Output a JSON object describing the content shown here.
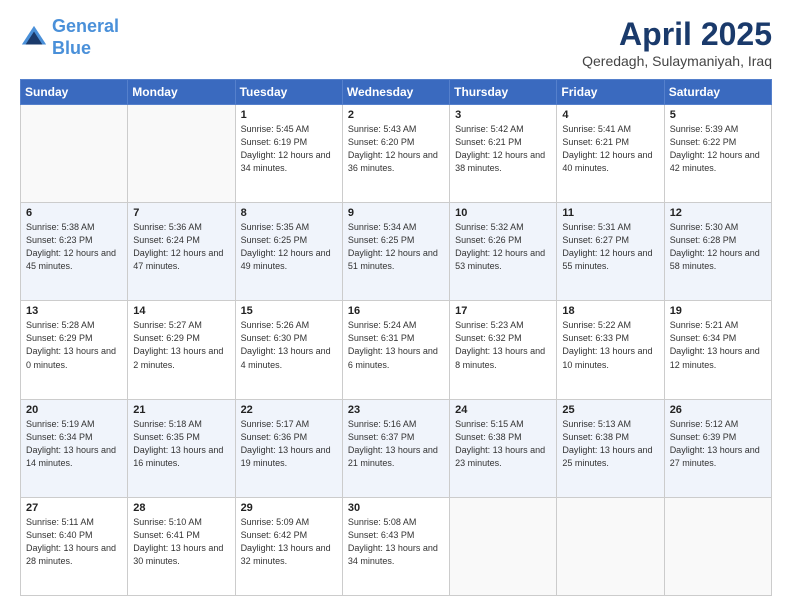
{
  "logo": {
    "line1": "General",
    "line2": "Blue"
  },
  "header": {
    "month": "April 2025",
    "location": "Qeredagh, Sulaymaniyah, Iraq"
  },
  "weekdays": [
    "Sunday",
    "Monday",
    "Tuesday",
    "Wednesday",
    "Thursday",
    "Friday",
    "Saturday"
  ],
  "weeks": [
    [
      {
        "day": "",
        "info": ""
      },
      {
        "day": "",
        "info": ""
      },
      {
        "day": "1",
        "info": "Sunrise: 5:45 AM\nSunset: 6:19 PM\nDaylight: 12 hours and 34 minutes."
      },
      {
        "day": "2",
        "info": "Sunrise: 5:43 AM\nSunset: 6:20 PM\nDaylight: 12 hours and 36 minutes."
      },
      {
        "day": "3",
        "info": "Sunrise: 5:42 AM\nSunset: 6:21 PM\nDaylight: 12 hours and 38 minutes."
      },
      {
        "day": "4",
        "info": "Sunrise: 5:41 AM\nSunset: 6:21 PM\nDaylight: 12 hours and 40 minutes."
      },
      {
        "day": "5",
        "info": "Sunrise: 5:39 AM\nSunset: 6:22 PM\nDaylight: 12 hours and 42 minutes."
      }
    ],
    [
      {
        "day": "6",
        "info": "Sunrise: 5:38 AM\nSunset: 6:23 PM\nDaylight: 12 hours and 45 minutes."
      },
      {
        "day": "7",
        "info": "Sunrise: 5:36 AM\nSunset: 6:24 PM\nDaylight: 12 hours and 47 minutes."
      },
      {
        "day": "8",
        "info": "Sunrise: 5:35 AM\nSunset: 6:25 PM\nDaylight: 12 hours and 49 minutes."
      },
      {
        "day": "9",
        "info": "Sunrise: 5:34 AM\nSunset: 6:25 PM\nDaylight: 12 hours and 51 minutes."
      },
      {
        "day": "10",
        "info": "Sunrise: 5:32 AM\nSunset: 6:26 PM\nDaylight: 12 hours and 53 minutes."
      },
      {
        "day": "11",
        "info": "Sunrise: 5:31 AM\nSunset: 6:27 PM\nDaylight: 12 hours and 55 minutes."
      },
      {
        "day": "12",
        "info": "Sunrise: 5:30 AM\nSunset: 6:28 PM\nDaylight: 12 hours and 58 minutes."
      }
    ],
    [
      {
        "day": "13",
        "info": "Sunrise: 5:28 AM\nSunset: 6:29 PM\nDaylight: 13 hours and 0 minutes."
      },
      {
        "day": "14",
        "info": "Sunrise: 5:27 AM\nSunset: 6:29 PM\nDaylight: 13 hours and 2 minutes."
      },
      {
        "day": "15",
        "info": "Sunrise: 5:26 AM\nSunset: 6:30 PM\nDaylight: 13 hours and 4 minutes."
      },
      {
        "day": "16",
        "info": "Sunrise: 5:24 AM\nSunset: 6:31 PM\nDaylight: 13 hours and 6 minutes."
      },
      {
        "day": "17",
        "info": "Sunrise: 5:23 AM\nSunset: 6:32 PM\nDaylight: 13 hours and 8 minutes."
      },
      {
        "day": "18",
        "info": "Sunrise: 5:22 AM\nSunset: 6:33 PM\nDaylight: 13 hours and 10 minutes."
      },
      {
        "day": "19",
        "info": "Sunrise: 5:21 AM\nSunset: 6:34 PM\nDaylight: 13 hours and 12 minutes."
      }
    ],
    [
      {
        "day": "20",
        "info": "Sunrise: 5:19 AM\nSunset: 6:34 PM\nDaylight: 13 hours and 14 minutes."
      },
      {
        "day": "21",
        "info": "Sunrise: 5:18 AM\nSunset: 6:35 PM\nDaylight: 13 hours and 16 minutes."
      },
      {
        "day": "22",
        "info": "Sunrise: 5:17 AM\nSunset: 6:36 PM\nDaylight: 13 hours and 19 minutes."
      },
      {
        "day": "23",
        "info": "Sunrise: 5:16 AM\nSunset: 6:37 PM\nDaylight: 13 hours and 21 minutes."
      },
      {
        "day": "24",
        "info": "Sunrise: 5:15 AM\nSunset: 6:38 PM\nDaylight: 13 hours and 23 minutes."
      },
      {
        "day": "25",
        "info": "Sunrise: 5:13 AM\nSunset: 6:38 PM\nDaylight: 13 hours and 25 minutes."
      },
      {
        "day": "26",
        "info": "Sunrise: 5:12 AM\nSunset: 6:39 PM\nDaylight: 13 hours and 27 minutes."
      }
    ],
    [
      {
        "day": "27",
        "info": "Sunrise: 5:11 AM\nSunset: 6:40 PM\nDaylight: 13 hours and 28 minutes."
      },
      {
        "day": "28",
        "info": "Sunrise: 5:10 AM\nSunset: 6:41 PM\nDaylight: 13 hours and 30 minutes."
      },
      {
        "day": "29",
        "info": "Sunrise: 5:09 AM\nSunset: 6:42 PM\nDaylight: 13 hours and 32 minutes."
      },
      {
        "day": "30",
        "info": "Sunrise: 5:08 AM\nSunset: 6:43 PM\nDaylight: 13 hours and 34 minutes."
      },
      {
        "day": "",
        "info": ""
      },
      {
        "day": "",
        "info": ""
      },
      {
        "day": "",
        "info": ""
      }
    ]
  ]
}
